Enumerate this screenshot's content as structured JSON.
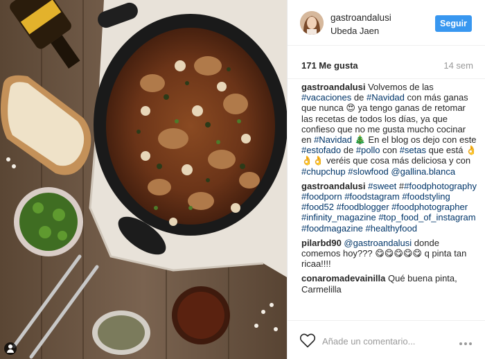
{
  "post": {
    "username": "gastroandalusi",
    "location": "Ubeda Jaen",
    "follow_label": "Seguir",
    "likes": "171 Me gusta",
    "time": "14 sem"
  },
  "caption": {
    "user": "gastroandalusi",
    "parts": [
      {
        "t": " Volvemos de las "
      },
      {
        "t": "#vacaciones",
        "tag": true
      },
      {
        "t": " de "
      },
      {
        "t": "#Navidad",
        "tag": true
      },
      {
        "t": " con más ganas que nunca 😍 ya tengo ganas de retomar las recetas de todos los días, ya que confieso que no me gusta mucho cocinar en "
      },
      {
        "t": "#Navidad",
        "tag": true
      },
      {
        "t": " 🎄 En el blog os dejo con este "
      },
      {
        "t": "#estofado",
        "tag": true
      },
      {
        "t": " de "
      },
      {
        "t": "#pollo",
        "tag": true
      },
      {
        "t": " con "
      },
      {
        "t": "#setas",
        "tag": true
      },
      {
        "t": " que está 👌👌👌 veréis que cosa más deliciosa y con "
      },
      {
        "t": "#chupchup",
        "tag": true
      },
      {
        "t": " "
      },
      {
        "t": "#slowfood",
        "tag": true
      },
      {
        "t": " "
      },
      {
        "t": "@gallina.blanca",
        "tag": true
      }
    ]
  },
  "comments": [
    {
      "user": "gastroandalusi",
      "parts": [
        {
          "t": " "
        },
        {
          "t": "#sweet",
          "tag": true
        },
        {
          "t": " #"
        },
        {
          "t": "#foodphotography",
          "tag": true
        },
        {
          "t": " "
        },
        {
          "t": "#foodporn",
          "tag": true
        },
        {
          "t": " "
        },
        {
          "t": "#foodstagram",
          "tag": true
        },
        {
          "t": " "
        },
        {
          "t": "#foodstyling",
          "tag": true
        },
        {
          "t": " "
        },
        {
          "t": "#food52",
          "tag": true
        },
        {
          "t": " "
        },
        {
          "t": "#foodblogger",
          "tag": true
        },
        {
          "t": " "
        },
        {
          "t": "#foodphotographer",
          "tag": true
        },
        {
          "t": " "
        },
        {
          "t": "#infinity_magazine",
          "tag": true
        },
        {
          "t": " "
        },
        {
          "t": "#top_food_of_instagram",
          "tag": true
        },
        {
          "t": " "
        },
        {
          "t": "#foodmagazine",
          "tag": true
        },
        {
          "t": " "
        },
        {
          "t": "#healthyfood",
          "tag": true
        }
      ]
    },
    {
      "user": "pilarbd90",
      "parts": [
        {
          "t": " "
        },
        {
          "t": "@gastroandalusi",
          "tag": true
        },
        {
          "t": " donde comemos hoy??? 😋😋😋😋😋 q pinta tan ricaa!!!!"
        }
      ]
    },
    {
      "user": "conaromadevainilla",
      "parts": [
        {
          "t": " Qué buena pinta, Carmelilla"
        }
      ]
    }
  ],
  "add_comment": {
    "placeholder": "Añade un comentario..."
  },
  "icons": {
    "like": "heart-icon",
    "more": "more-options-icon",
    "photo_tag": "user-tag-icon"
  },
  "colors": {
    "follow_button": "#3897f0",
    "hashtag": "#003569",
    "meta_text": "#999999"
  }
}
